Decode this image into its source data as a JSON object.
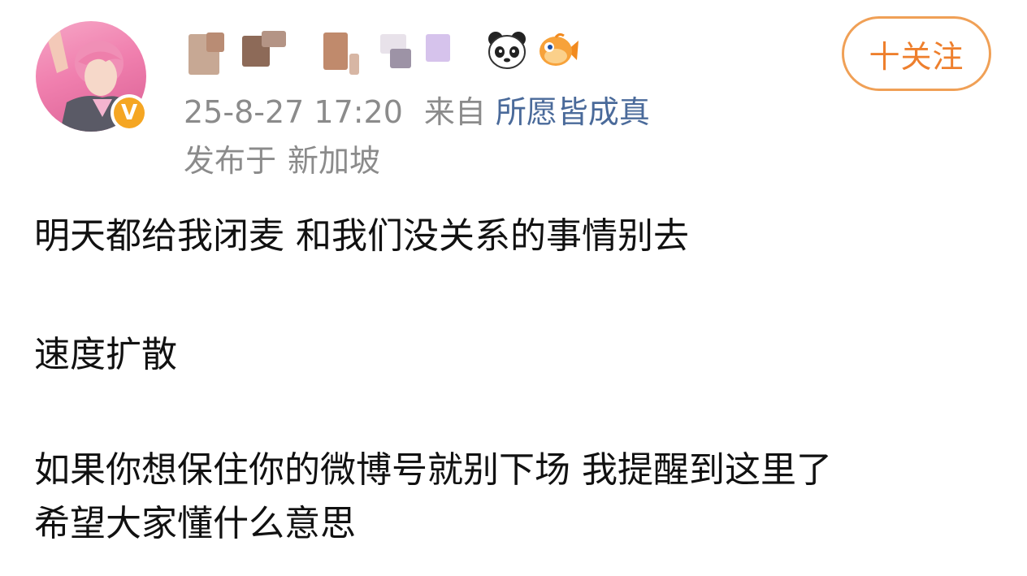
{
  "post": {
    "author": {
      "verified_icon": "verified-badge-icon",
      "emojis": [
        "panda-icon",
        "fish-icon"
      ]
    },
    "follow_label": "十关注",
    "timestamp": "25-8-27 17:20",
    "from_label": "来自",
    "source": "所愿皆成真",
    "published_label": "发布于",
    "location": "新加坡",
    "paragraphs": [
      "明天都给我闭麦 和我们没关系的事情别去",
      "速度扩散",
      "如果你想保住你的微博号就别下场 我提醒到这里了",
      "希望大家懂什么意思"
    ]
  },
  "colors": {
    "accent_orange": "#ee7f2d",
    "meta_gray": "#8b8b8b",
    "link_blue": "#4a6a9a",
    "verified_gold": "#f5a623"
  }
}
